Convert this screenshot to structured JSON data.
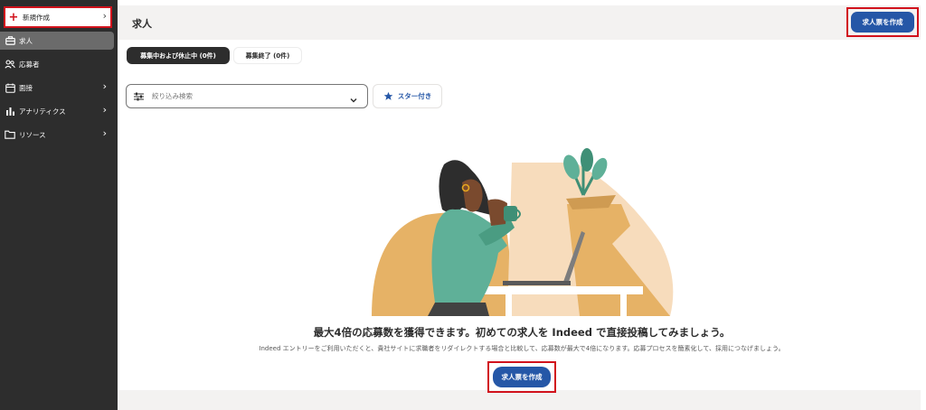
{
  "sidebar": {
    "new_label": "新規作成",
    "items": [
      {
        "label": "求人",
        "icon": "briefcase-icon"
      },
      {
        "label": "応募者",
        "icon": "people-icon"
      },
      {
        "label": "面接",
        "icon": "calendar-icon"
      },
      {
        "label": "アナリティクス",
        "icon": "bar-chart-icon"
      },
      {
        "label": "リソース",
        "icon": "folder-icon"
      }
    ]
  },
  "header": {
    "title": "求人",
    "create_button": "求人票を作成"
  },
  "tabs": [
    {
      "label": "募集中および休止中 (0件)",
      "active": true
    },
    {
      "label": "募集終了 (0件)",
      "active": false
    }
  ],
  "filter": {
    "placeholder": "絞り込み検索"
  },
  "star_filter": {
    "label": "スター付き"
  },
  "empty_state": {
    "title": "最大4倍の応募数を獲得できます。初めての求人を Indeed で直接投稿してみましょう。",
    "subtitle": "Indeed エントリーをご利用いただくと、貴社サイトに求職者をリダイレクトする場合と比較して、応募数が最大で4倍になります。応募プロセスを簡素化して、採用につなげましょう。",
    "create_button": "求人票を作成"
  },
  "colors": {
    "primary": "#2557a7",
    "sidebar_bg": "#2d2d2d",
    "highlight": "#d1121c"
  }
}
